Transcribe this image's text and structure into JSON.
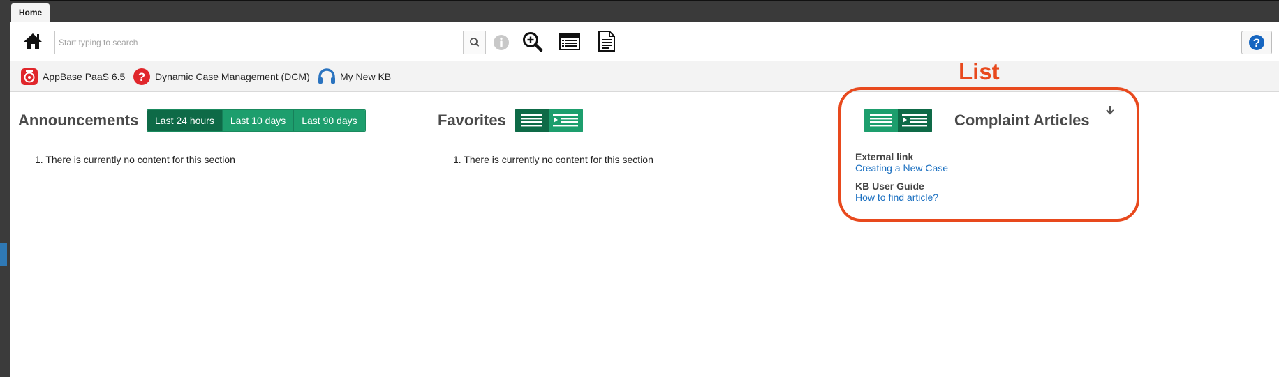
{
  "window": {
    "tab_label": "Home"
  },
  "toolbar": {
    "search_placeholder": "Start typing to search",
    "icons": [
      "home-icon",
      "search-icon",
      "info-icon",
      "zoom-in-icon",
      "list-view-icon",
      "document-icon",
      "help-icon"
    ]
  },
  "kb_bar": {
    "items": [
      {
        "label": "AppBase PaaS 6.5",
        "icon": "appbase-icon",
        "color": "#e0262b"
      },
      {
        "label": "Dynamic Case Management (DCM)",
        "icon": "question-icon",
        "color": "#e0262b"
      },
      {
        "label": "My New KB",
        "icon": "headset-icon",
        "color": "#2a73bf"
      }
    ]
  },
  "announcements": {
    "title": "Announcements",
    "filters": [
      "Last 24 hours",
      "Last 10 days",
      "Last 90 days"
    ],
    "selected_filter": "Last 24 hours",
    "empty_message": "1. There is currently no content for this section"
  },
  "favorites": {
    "title": "Favorites",
    "empty_message": "1. There is currently no content for this section"
  },
  "complaint_articles": {
    "title": "Complaint Articles",
    "groups": [
      {
        "category": "External link",
        "link": "Creating a New Case"
      },
      {
        "category": "KB User Guide",
        "link": "How to find article?"
      }
    ]
  },
  "annotation": {
    "label": "List",
    "color": "#e8491d"
  },
  "colors": {
    "accent_dark": "#0e6a47",
    "accent": "#1d9e6d",
    "link": "#1a6fc0"
  }
}
